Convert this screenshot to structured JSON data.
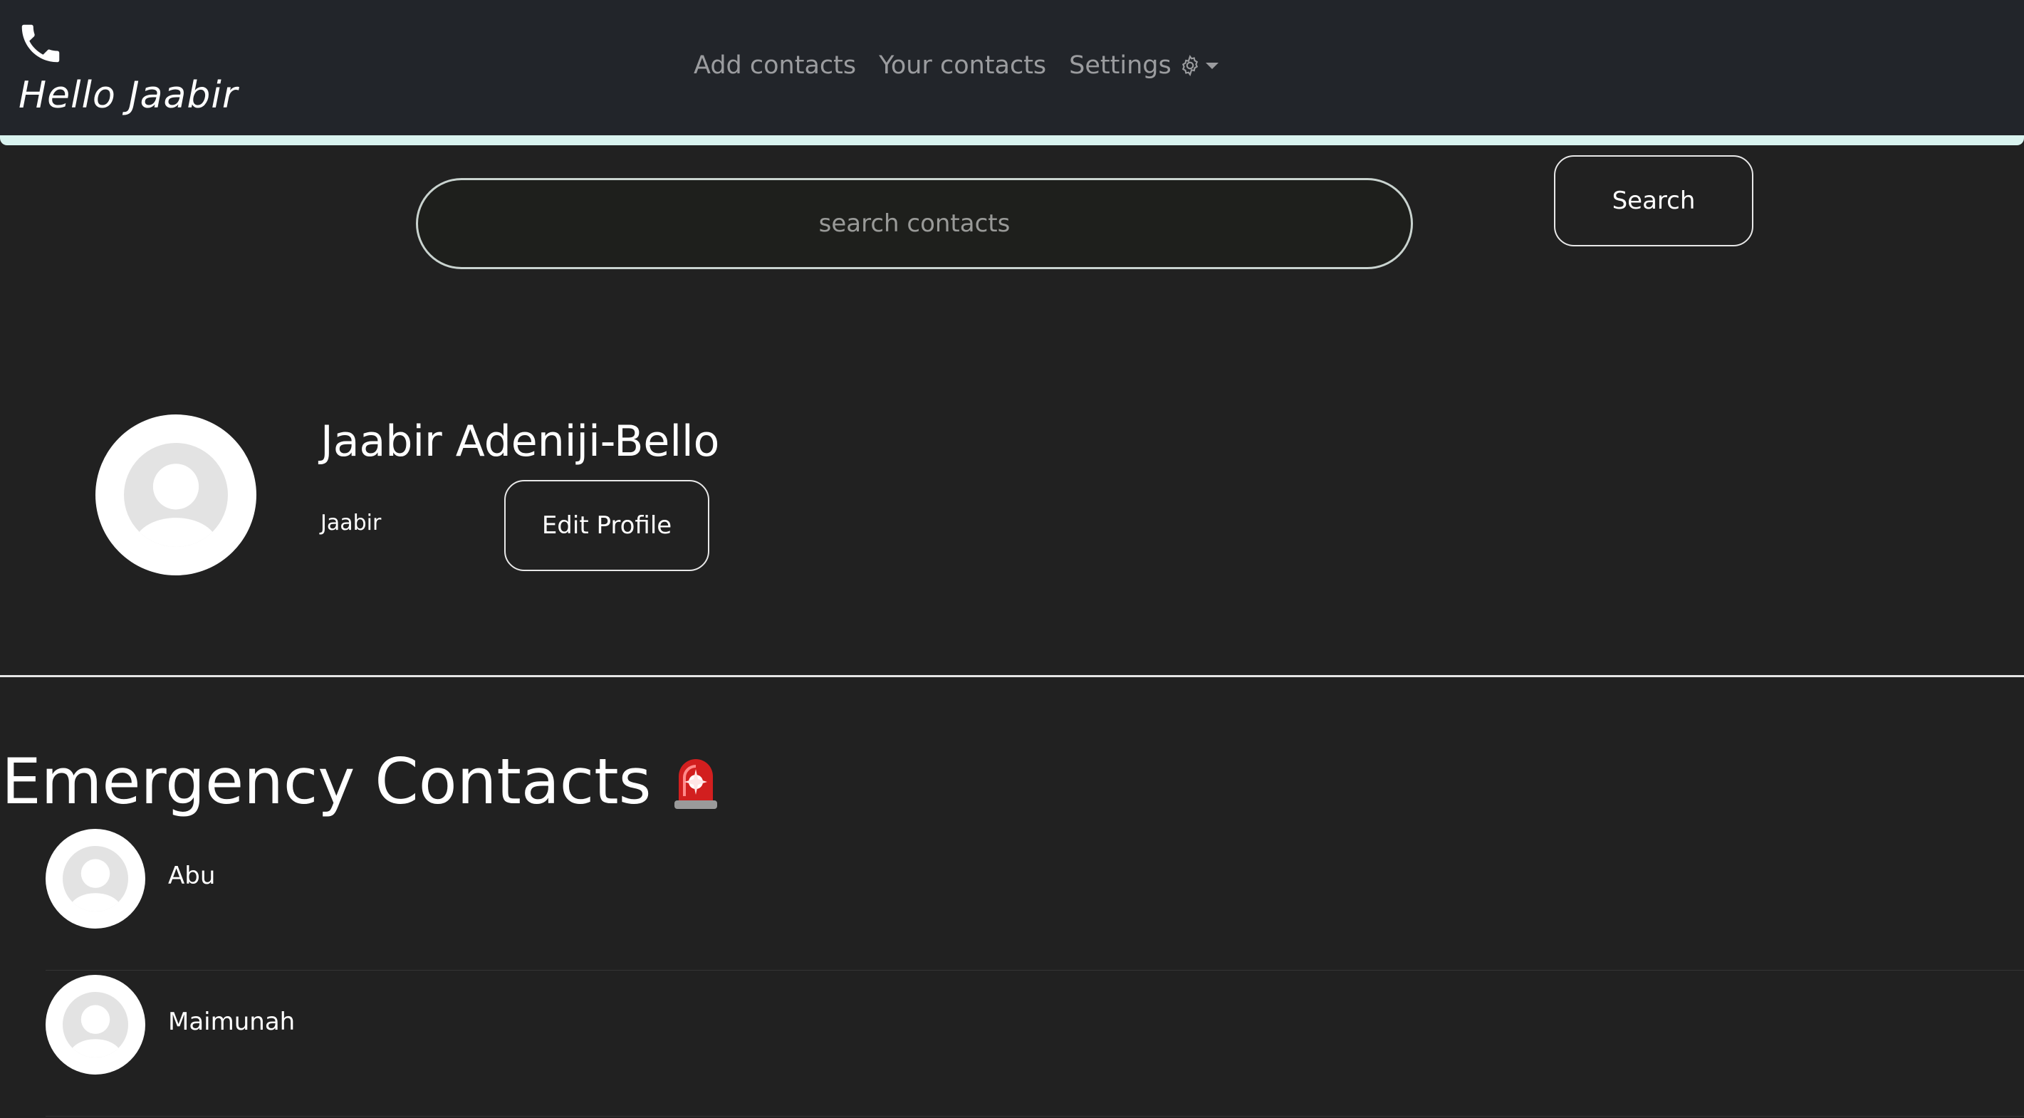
{
  "navbar": {
    "brand_icon": "phone-icon",
    "greeting": "Hello Jaabir",
    "links": [
      {
        "label": "Add contacts"
      },
      {
        "label": "Your contacts"
      }
    ],
    "settings": {
      "label": "Settings",
      "icon": "gear-icon",
      "dropdown_icon": "caret-down-icon"
    },
    "accent_color": "#d9f3ef"
  },
  "search": {
    "placeholder": "search contacts",
    "value": "",
    "button_label": "Search"
  },
  "profile": {
    "full_name": "Jaabir Adeniji-Bello",
    "username": "Jaabir",
    "edit_button_label": "Edit Profile",
    "avatar_icon": "default-avatar-icon"
  },
  "emergency": {
    "title": "Emergency Contacts",
    "title_icon": "siren-icon",
    "contacts": [
      {
        "name": "Abu"
      },
      {
        "name": "Maimunah"
      }
    ]
  },
  "colors": {
    "background": "#212121",
    "navbar": "#22252a",
    "text": "#ffffff",
    "muted_text": "#8c8c8c"
  }
}
